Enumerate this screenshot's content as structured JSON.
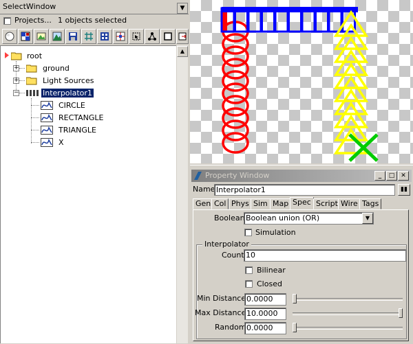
{
  "select_window": {
    "title": "SelectWindow",
    "projects_label": "Projects...",
    "selected_count": "1 objects selected",
    "toolbar_icons": [
      "sphere-icon",
      "pattern-icon",
      "image-icon",
      "mountain-icon",
      "save-icon",
      "grid-icon",
      "checker-icon",
      "target-icon",
      "select-icon",
      "nodes-icon",
      "frame-icon",
      "export-icon"
    ]
  },
  "tree": {
    "root": "root",
    "ground": "ground",
    "light_sources": "Light Sources",
    "interpolator": "Interpolator1",
    "children": [
      "CIRCLE",
      "RECTANGLE",
      "TRIANGLE",
      "X"
    ]
  },
  "property_window": {
    "title": "Property Window",
    "name_label": "Name",
    "name_value": "Interpolator1",
    "tabs": [
      "Gen",
      "Col",
      "Phys",
      "Sim",
      "Map",
      "Spec",
      "Script",
      "Wire",
      "Tags"
    ],
    "active_tab": "Spec",
    "boolean_label": "Boolean",
    "boolean_value": "Boolean union (OR)",
    "simulation_label": "Simulation",
    "interpolator_group": "Interpolator",
    "count_label": "Count",
    "count_value": "10",
    "bilinear_label": "Bilinear",
    "closed_label": "Closed",
    "min_distance_label": "Min Distance",
    "min_distance_value": "0.0000",
    "max_distance_label": "Max Distance",
    "max_distance_value": "10.0000",
    "random_label": "Random",
    "random_value": "0.0000",
    "sliders": {
      "min_distance_fraction": 0.0,
      "max_distance_fraction": 1.0,
      "random_fraction": 0.0
    }
  },
  "colors": {
    "selection": "#0a246a",
    "shape_red": "#ff0000",
    "shape_blue": "#0000ff",
    "shape_yellow": "#ffff00",
    "shape_green": "#00cc00"
  }
}
